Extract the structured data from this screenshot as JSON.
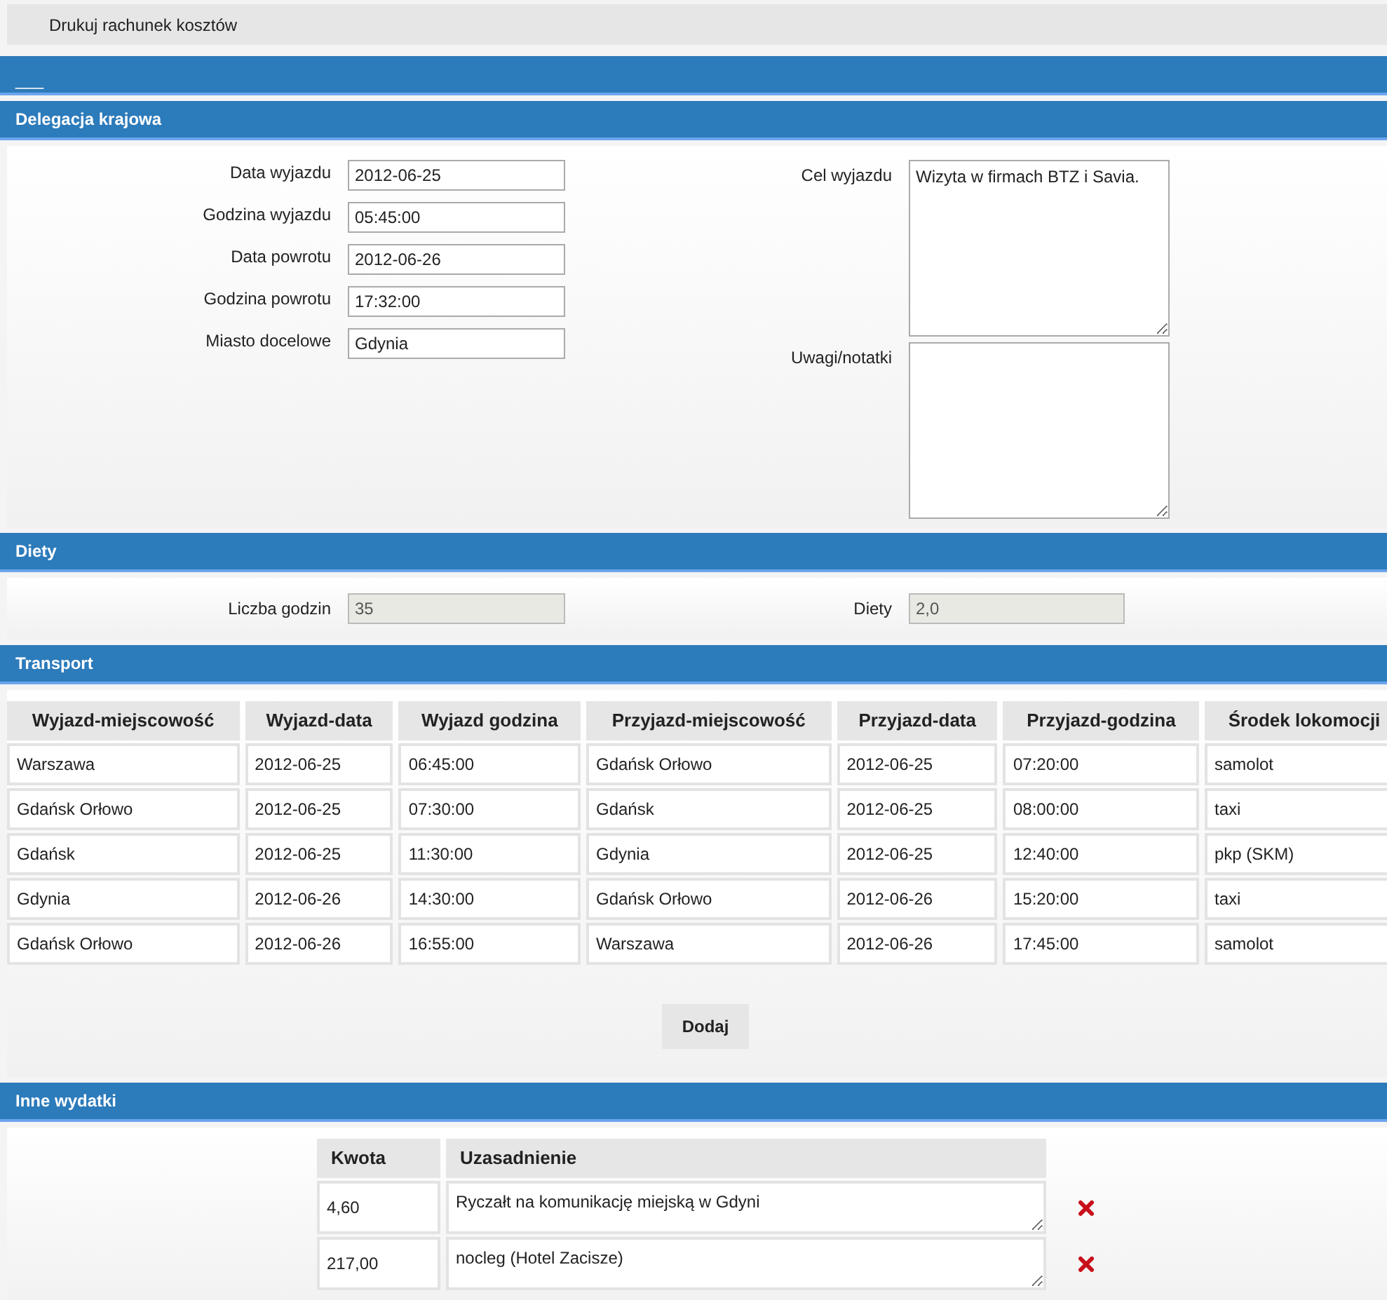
{
  "toolbar": {
    "print_link": "Drukuj rachunek kosztów"
  },
  "top_bar": {
    "link": "___"
  },
  "trip": {
    "title": "Delegacja krajowa",
    "fields": [
      {
        "label": "Data wyjazdu",
        "value": "2012-06-25"
      },
      {
        "label": "Godzina wyjazdu",
        "value": "05:45:00"
      },
      {
        "label": "Data powrotu",
        "value": "2012-06-26"
      },
      {
        "label": "Godzina powrotu",
        "value": "17:32:00"
      },
      {
        "label": "Miasto docelowe",
        "value": "Gdynia"
      }
    ],
    "notes": [
      {
        "label": "Cel wyjazdu",
        "value": "Wizyta w firmach BTZ i Savia."
      },
      {
        "label": "Uwagi/notatki"
      }
    ]
  },
  "allowance": {
    "title": "Diety",
    "fields": [
      {
        "label": "Liczba godzin",
        "value": "35",
        "disabled": true
      },
      {
        "label": "Diety",
        "value": "2,0",
        "disabled": true
      }
    ]
  },
  "transport": {
    "title": "Transport",
    "columns": [
      "Wyjazd-miejscowość",
      "Wyjazd-data",
      "Wyjazd godzina",
      "Przyjazd-miejscowość",
      "Przyjazd-data",
      "Przyjazd-godzina",
      "Środek lokomocji"
    ],
    "rows": [
      [
        "Warszawa",
        "2012-06-25",
        "06:45:00",
        "Gdańsk Orłowo",
        "2012-06-25",
        "07:20:00",
        "samolot"
      ],
      [
        "Gdańsk Orłowo",
        "2012-06-25",
        "07:30:00",
        "Gdańsk",
        "2012-06-25",
        "08:00:00",
        "taxi"
      ],
      [
        "Gdańsk",
        "2012-06-25",
        "11:30:00",
        "Gdynia",
        "2012-06-25",
        "12:40:00",
        "pkp (SKM)"
      ],
      [
        "Gdynia",
        "2012-06-26",
        "14:30:00",
        "Gdańsk Orłowo",
        "2012-06-26",
        "15:20:00",
        "taxi"
      ],
      [
        "Gdańsk Orłowo",
        "2012-06-26",
        "16:55:00",
        "Warszawa",
        "2012-06-26",
        "17:45:00",
        "samolot"
      ]
    ],
    "add_button": "Dodaj"
  },
  "expenses": {
    "title": "Inne wydatki",
    "columns": [
      "Kwota",
      "Uzasadnienie"
    ],
    "rows": [
      {
        "amount": "4,60",
        "reason": "Ryczałt na komunikację miejską w Gdyni"
      },
      {
        "amount": "217,00",
        "reason": "nocleg (Hotel Zacisze)"
      }
    ]
  }
}
